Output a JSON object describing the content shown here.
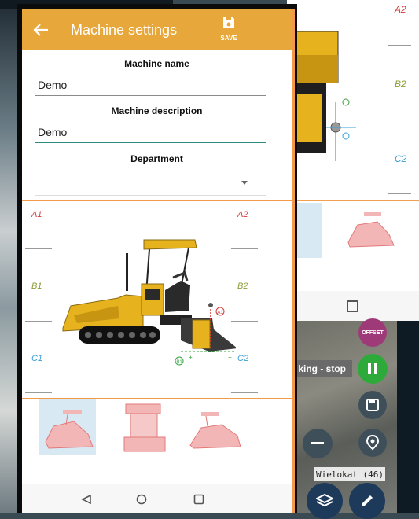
{
  "app": {
    "title": "Machine settings",
    "save_label": "SAVE"
  },
  "form": {
    "machine_name_label": "Machine name",
    "machine_name_value": "Demo",
    "machine_description_label": "Machine description",
    "machine_description_value": "Demo",
    "department_label": "Department",
    "department_value": ""
  },
  "sensors": {
    "a1": "A1",
    "a2": "A2",
    "b1": "B1",
    "b2": "B2",
    "c1": "C1",
    "c2": "C2"
  },
  "diagram_markers": {
    "a1": "A1",
    "b1": "B1",
    "b2": "B2",
    "c2": "C2"
  },
  "second_screen": {
    "a2": "A2",
    "b2": "B2",
    "c2": "C2"
  },
  "map_overlay": {
    "offset_label": "OFFSET",
    "status_text": "king - stop",
    "layer_label": "Wielokat (46)"
  },
  "colors": {
    "accent": "#e8a73a",
    "orange_line": "#f39a4a",
    "focus_underline": "#2f8a82",
    "a_color": "#d13a3a",
    "b_color": "#8d9a35",
    "c_color": "#3a9fd8"
  }
}
